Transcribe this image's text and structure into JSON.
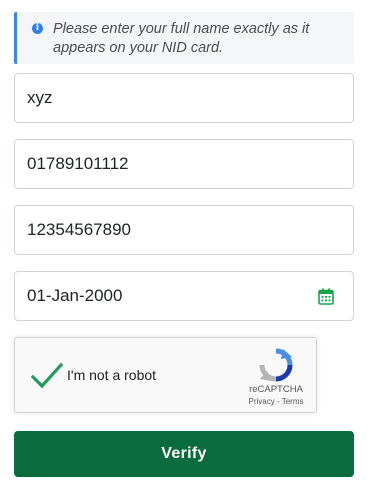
{
  "notice": {
    "icon": "info-icon",
    "text": "Please enter your full name exactly as it appears on your NID card.",
    "accent_color": "#3a87e8"
  },
  "form": {
    "full_name_value": "xyz",
    "phone_value": "01789101112",
    "nid_value": "12354567890",
    "dob_value": "01-Jan-2000",
    "calendar_icon": "calendar-icon",
    "calendar_icon_color": "#16a34a"
  },
  "captcha": {
    "label": "I'm not a robot",
    "checked": true,
    "check_color": "#1f9e5a",
    "brand": "reCAPTCHA",
    "privacy": "Privacy",
    "separator": " - ",
    "terms": "Terms"
  },
  "actions": {
    "verify_label": "Verify",
    "verify_color": "#0a6b3f"
  }
}
